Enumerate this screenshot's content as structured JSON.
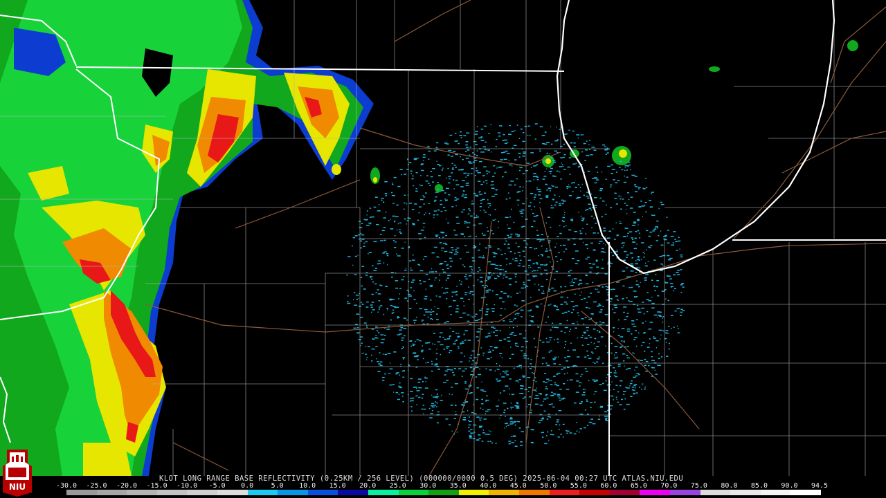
{
  "product_caption": "KLOT LONG RANGE BASE REFLECTIVITY (0.25KM / 256 LEVEL) (000000/0000 0.5 DEG) 2025-06-04 00:27 UTC  ATLAS.NIU.EDU",
  "logo_text": "NIU",
  "scale": {
    "labels": [
      "-30.0",
      "-25.0",
      "-20.0",
      "-15.0",
      "-10.0",
      "-5.0",
      "0.0",
      "5.0",
      "10.0",
      "15.0",
      "20.0",
      "25.0",
      "30.0",
      "35.0",
      "40.0",
      "45.0",
      "50.0",
      "55.0",
      "60.0",
      "65.0",
      "70.0",
      "75.0",
      "80.0",
      "85.0",
      "90.0",
      "94.5"
    ],
    "colors": [
      "#9a9a9a",
      "#a6a6a6",
      "#b4b4b4",
      "#c2c2c2",
      "#cfcfcf",
      "#dcdcdc",
      "#1ec8f0",
      "#0a96e6",
      "#0a50dc",
      "#0a0aa0",
      "#0af0a0",
      "#0ad23c",
      "#14a014",
      "#f0f000",
      "#f0b400",
      "#f07800",
      "#f01e1e",
      "#c80000",
      "#a00032",
      "#f000f0",
      "#9646dc",
      "#dcdcdc",
      "#e8e8e8",
      "#f4f4f4",
      "#ffffff"
    ]
  },
  "colors": {
    "background": "#000000",
    "state_line": "#ffffff",
    "county_line": "#b4b4b4",
    "road": "#8c5a3c",
    "clutter": "#1eb4dc"
  }
}
